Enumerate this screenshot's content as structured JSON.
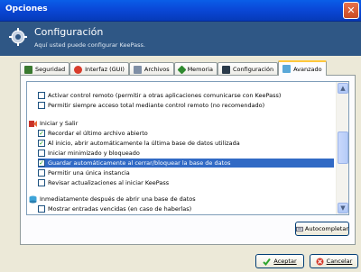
{
  "window": {
    "title": "Opciones",
    "close": "✕"
  },
  "banner": {
    "title": "Configuración",
    "subtitle": "Aquí usted puede configurar KeePass."
  },
  "tabs": [
    {
      "label": "Seguridad",
      "color": "#3a7a30"
    },
    {
      "label": "Interfaz (GUI)",
      "color": "#d83c2c"
    },
    {
      "label": "Archivos",
      "color": "#7f8fa6"
    },
    {
      "label": "Memoria",
      "color": "#2f8a2f"
    },
    {
      "label": "Configuración",
      "color": "#2a3a4a"
    },
    {
      "label": "Avanzado",
      "color": "#5aa8d8"
    }
  ],
  "options": {
    "remote_control": "Activar control remoto (permitir a otras aplicaciones comunicarse con KeePass)",
    "remote_full": "Permitir siempre acceso total mediante control remoto (no recomendado)",
    "group_start": "Iniciar y Salir",
    "remember_last": "Recordar el último archivo abierto",
    "autoopen_last": "Al inicio, abrir automáticamente la última base de datos utilizada",
    "start_minimized": "Iniciar minimizado y bloqueado",
    "autosave": "Guardar automáticamente al cerrar/bloquear la base de datos",
    "single_instance": "Permitir una única instancia",
    "check_updates": "Revisar actualizaciones al iniciar KeePass",
    "group_after_open": "Inmediatamente después de abrir una base de datos",
    "show_expired": "Mostrar entradas vencidas (en caso de haberlas)"
  },
  "buttons": {
    "autocomplete": "Autocompletar",
    "accept": "Aceptar",
    "cancel": "Cancelar"
  },
  "scroll": {
    "up": "▲",
    "down": "▼"
  }
}
